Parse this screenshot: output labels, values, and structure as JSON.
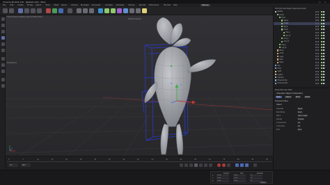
{
  "app": {
    "title": "Cinema 4D R23.110 - [Rabbit.c4d] - Main"
  },
  "window_controls": [
    "minimize-icon",
    "maximize-icon",
    "close-icon"
  ],
  "menu": {
    "items": [
      "File",
      "Edit",
      "Create",
      "Modes",
      "Select",
      "Tools",
      "Mesh",
      "Spline",
      "Volume",
      "MoGraph",
      "Character",
      "Animate",
      "Simulate",
      "Tracker",
      "Render",
      "Extensions",
      "Window",
      "Help"
    ],
    "layout_label": "Startup"
  },
  "viewport": {
    "menu": "View  Cameras  Display  Options  Filter  Panel",
    "camera_label": "Default Camera",
    "grid_label": "Perspective",
    "axis_x_color": "#c03a3a",
    "axis_y_color": "#3fae4a",
    "model_color": "#a9abb0",
    "wire_color": "#2a3bd8"
  },
  "timeline": {
    "ticks": [
      "0",
      "5",
      "10",
      "15",
      "20",
      "25",
      "30",
      "35",
      "40",
      "45",
      "50",
      "55",
      "60",
      "65",
      "70",
      "75",
      "80",
      "85",
      "90"
    ],
    "current_frame": "0 F",
    "end_frame": "90 F"
  },
  "coords": {
    "headers": [
      "Position",
      "Size",
      "Rotation"
    ],
    "rows": [
      {
        "axis": "X",
        "pos": "0 cm",
        "size": "0 cm",
        "rot": "0 °"
      },
      {
        "axis": "Y",
        "pos": "0 cm",
        "size": "0 cm",
        "rot": "0 °"
      },
      {
        "axis": "Z",
        "pos": "0 cm",
        "size": "0 cm",
        "rot": "0 °"
      }
    ],
    "apply_label": "Apply"
  },
  "object_manager": {
    "tabs": "File  Edit  View  Object  Tags  Bookmarks",
    "rows": [
      {
        "name": "Rabbit",
        "indent": 0,
        "color": "#c8ccd4",
        "selected": false
      },
      {
        "name": "Joints",
        "indent": 1,
        "color": "#8fc96d",
        "selected": false
      },
      {
        "name": "Root",
        "indent": 2,
        "color": "#8fc96d",
        "selected": false
      },
      {
        "name": "Spine",
        "indent": 3,
        "color": "#8fc96d",
        "selected": false
      },
      {
        "name": "Chest",
        "indent": 3,
        "color": "#8fc96d",
        "selected": true
      },
      {
        "name": "Neck",
        "indent": 3,
        "color": "#8fc96d",
        "selected": false
      },
      {
        "name": "Head",
        "indent": 3,
        "color": "#8fc96d",
        "selected": false
      },
      {
        "name": "Ear_L",
        "indent": 4,
        "color": "#8fc96d",
        "selected": false
      },
      {
        "name": "Ear_R",
        "indent": 4,
        "color": "#8fc96d",
        "selected": false
      },
      {
        "name": "Arm_L",
        "indent": 3,
        "color": "#8fc96d",
        "selected": false
      },
      {
        "name": "Arm_R",
        "indent": 3,
        "color": "#8fc96d",
        "selected": false
      },
      {
        "name": "Leg_L",
        "indent": 2,
        "color": "#8fc96d",
        "selected": false
      },
      {
        "name": "Leg_R",
        "indent": 2,
        "color": "#8fc96d",
        "selected": false
      },
      {
        "name": "Body",
        "indent": 1,
        "color": "#d0b06a",
        "selected": false
      },
      {
        "name": "Arms",
        "indent": 1,
        "color": "#d0b06a",
        "selected": false
      },
      {
        "name": "Legs",
        "indent": 1,
        "color": "#d0b06a",
        "selected": false
      },
      {
        "name": "Ears",
        "indent": 1,
        "color": "#d0b06a",
        "selected": false
      },
      {
        "name": "Eyes",
        "indent": 1,
        "color": "#d0b06a",
        "selected": false
      },
      {
        "name": "Sky",
        "indent": 0,
        "color": "#7aa8d8",
        "selected": false
      },
      {
        "name": "Floor",
        "indent": 0,
        "color": "#7aa8d8",
        "selected": false
      },
      {
        "name": "Light",
        "indent": 0,
        "color": "#e0d27a",
        "selected": false
      },
      {
        "name": "Light.1",
        "indent": 0,
        "color": "#e0d27a",
        "selected": false
      },
      {
        "name": "Camera",
        "indent": 0,
        "color": "#b0b0b8",
        "selected": false
      },
      {
        "name": "Physical Sky",
        "indent": 0,
        "color": "#7aa8d8",
        "selected": false
      },
      {
        "name": "Environment",
        "indent": 0,
        "color": "#7aa8d8",
        "selected": false
      }
    ]
  },
  "attributes": {
    "tabs": "Mode  Edit  User Data",
    "title": "Character Object [Character]",
    "buttons": [
      {
        "label": "Basic",
        "color": "#4a5a8c"
      },
      {
        "label": "Object",
        "color": "#3a3a40"
      },
      {
        "label": "Build",
        "color": "#3a3a40"
      },
      {
        "label": "Adjust",
        "color": "#3a3a40"
      }
    ],
    "section": "Character Menu",
    "subsection": "Object",
    "fields": [
      {
        "label": "Template",
        "value": "Biped"
      },
      {
        "label": "Build Mode",
        "value": "Build"
      },
      {
        "label": "Mirror",
        "value": "Left to Right"
      },
      {
        "label": "Display",
        "value": "Shaded"
      },
      {
        "label": "Components",
        "value": "All"
      },
      {
        "label": "Controllers",
        "value": "On"
      },
      {
        "label": "Bind",
        "value": "Bind"
      }
    ]
  }
}
